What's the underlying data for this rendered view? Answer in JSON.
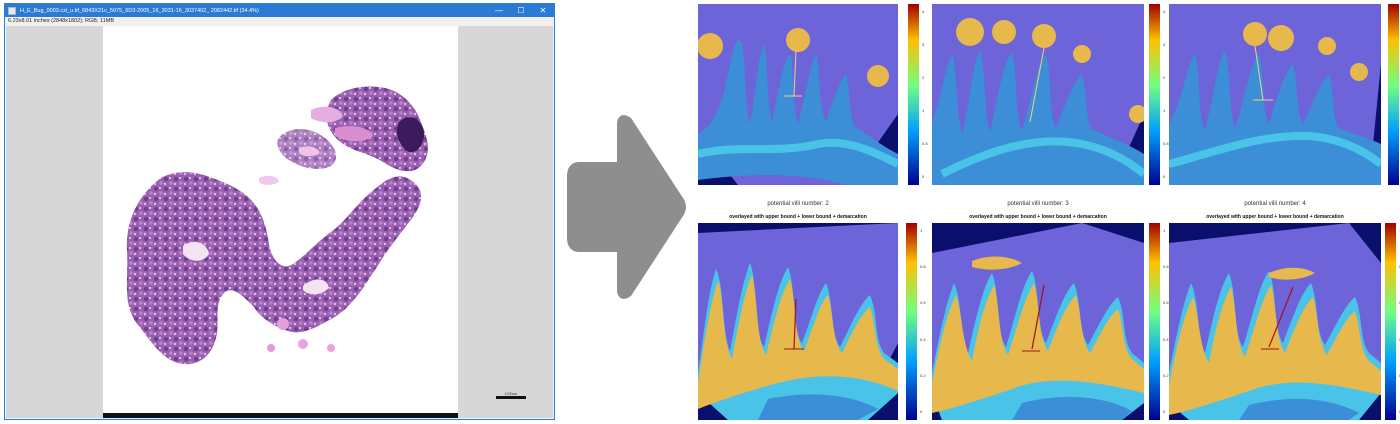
{
  "window": {
    "title": "H_E_Bug_0003.czi_u.tif_6843X21c_5075_6D3-2005_16_3031-16_3037402_ 2082442.tif (34.4%)",
    "info": "6.23x8.01 inches (2848x1802); RGB; 11MB",
    "controls": {
      "minimize": "—",
      "maximize": "☐",
      "close": "✕"
    }
  },
  "scale_bar": {
    "label": "1000um"
  },
  "panels": {
    "middle_titles": [
      {
        "title": "potential villi number: 2",
        "subtitle": "overlayed with upper bound + lower bound + demarcation"
      },
      {
        "title": "potential villi number: 3",
        "subtitle": "overlayed with upper bound + lower bound + demarcation"
      },
      {
        "title": "potential villi number: 4",
        "subtitle": "overlayed with upper bound + lower bound + demarcation"
      }
    ],
    "colorbar_ticks_top": [
      "4",
      "3",
      "2",
      "1",
      "0.5",
      "0"
    ],
    "colorbar_ticks_bottom": [
      "1",
      "0.8",
      "0.6",
      "0.4",
      "0.2",
      "0"
    ]
  },
  "colors": {
    "titlebar": "#2b7bd4",
    "arrow": "#8e8e8e",
    "background_navy": "#0a0f6b",
    "field_violet": "#6c64d8",
    "tissue_yellow": "#e7b84b",
    "cyan": "#49c4e8"
  }
}
